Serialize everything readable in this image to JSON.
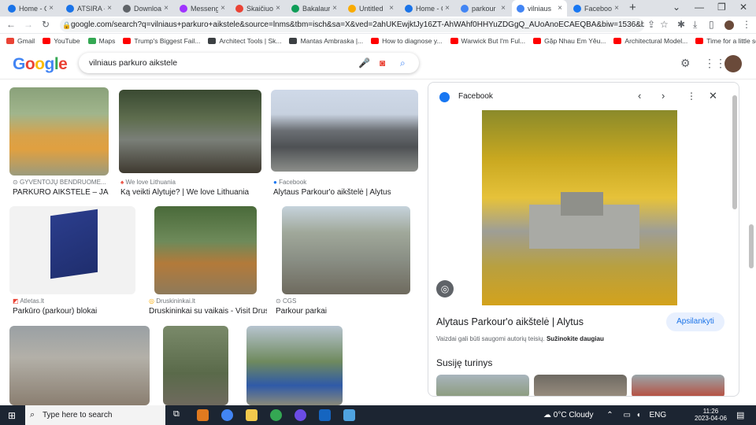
{
  "tabs": [
    {
      "label": "Home - C",
      "color": "#1a73e8",
      "active": false
    },
    {
      "label": "ATSIRA -",
      "color": "#1a73e8",
      "active": false
    },
    {
      "label": "Downloa",
      "color": "#5f6368",
      "active": false
    },
    {
      "label": "Messeng",
      "color": "#a033ff",
      "active": false
    },
    {
      "label": "Skaičiuok",
      "color": "#ea4335",
      "active": false
    },
    {
      "label": "Bakalaur",
      "color": "#0f9d58",
      "active": false
    },
    {
      "label": "Untitled",
      "color": "#f9ab00",
      "active": false
    },
    {
      "label": "Home - C",
      "color": "#1a73e8",
      "active": false
    },
    {
      "label": "parkour",
      "color": "#4285f4",
      "active": false
    },
    {
      "label": "vilniaus",
      "color": "#4285f4",
      "active": true
    },
    {
      "label": "Facebook",
      "color": "#1877f2",
      "active": false
    }
  ],
  "new_tab_glyph": "+",
  "address": {
    "url": "google.com/search?q=vilniaus+parkuro+aikstele&source=lnms&tbm=isch&sa=X&ved=2ahUKEwjktJy16ZT-AhWAhf0HHYuZDGgQ_AUoAnoECAEQBA&biw=1536&bih=722&dpr=1.25#i..."
  },
  "bookmarks": [
    {
      "label": "Gmail",
      "color": "#ea4335"
    },
    {
      "label": "YouTube",
      "color": "#ff0000"
    },
    {
      "label": "Maps",
      "color": "#34a853"
    },
    {
      "label": "Trump's Biggest Fail...",
      "color": "#ff0000"
    },
    {
      "label": "Architect Tools | Sk...",
      "color": "#3c4043"
    },
    {
      "label": "Mantas Ambraska |...",
      "color": "#3c4043"
    },
    {
      "label": "How to diagnose y...",
      "color": "#ff0000"
    },
    {
      "label": "Warwick But I'm Ful...",
      "color": "#ff0000"
    },
    {
      "label": "Gặp Nhau Em Yêu...",
      "color": "#ff0000"
    },
    {
      "label": "Architectural Model...",
      "color": "#ff0000"
    },
    {
      "label": "Time for a little son...",
      "color": "#ff0000"
    }
  ],
  "google": {
    "logo_letters": [
      "G",
      "o",
      "o",
      "g",
      "l",
      "e"
    ],
    "logo_colors": [
      "#4285f4",
      "#ea4335",
      "#fbbc05",
      "#4285f4",
      "#34a853",
      "#ea4335"
    ],
    "query": "vilniaus parkuro aikstele"
  },
  "results": [
    {
      "source": "GYVENTOJŲ BENDRUOME...",
      "title": "PARKŪRO AIKŠTELĖ – JAU..."
    },
    {
      "source": "We love Lithuania",
      "title": "Ką veikti Alytuje? | We love Lithuania"
    },
    {
      "source": "Facebook",
      "title": "Alytaus Parkour'o aikštelė | Alytus"
    },
    {
      "source": "Atletas.lt",
      "title": "Parkūro (parkour) blokai"
    },
    {
      "source": "Druskininkai.lt",
      "title": "Druskininkai su vaikais - Visit Drus..."
    },
    {
      "source": "CGS",
      "title": "Parkour parkai"
    }
  ],
  "panel": {
    "source": "Facebook",
    "title": "Alytaus Parkour'o aikštelė | Alytus",
    "visit": "Apsilankyti",
    "copyright_text": "Vaizdai gali būti saugomi autorių teisių.",
    "learn_more": "Sužinokite daugiau",
    "related": "Susiję turinys"
  },
  "taskbar": {
    "search_placeholder": "Type here to search",
    "weather": "0°C  Cloudy",
    "lang": "ENG",
    "time": "11:26",
    "date": "2023-04-06"
  }
}
